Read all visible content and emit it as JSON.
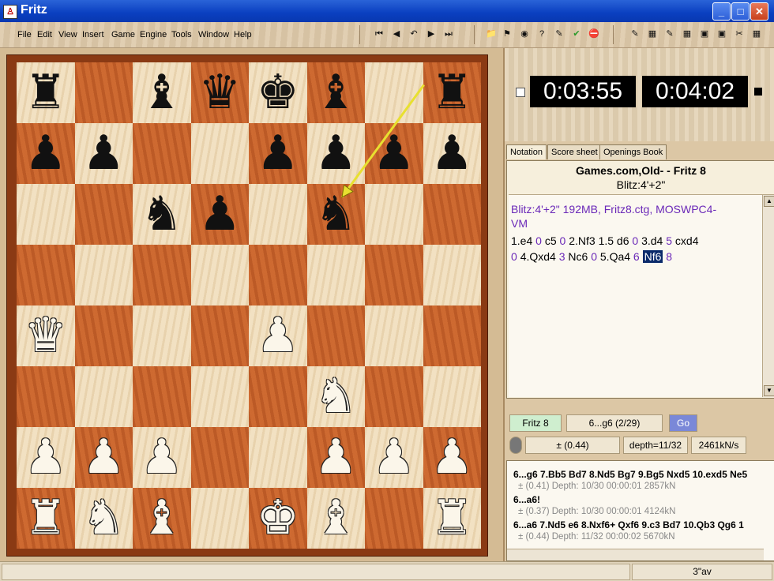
{
  "window": {
    "title": "Fritz",
    "app_icon": "chess-app-icon"
  },
  "menu": [
    "File",
    "Edit",
    "View",
    "Insert",
    "Game",
    "Engine",
    "Tools",
    "Window",
    "Help"
  ],
  "toolbar": {
    "nav": [
      "⏮",
      "◀",
      "↶",
      "▶",
      "⏭"
    ],
    "tools": [
      "📁",
      "⚑",
      "◉",
      "?",
      "✎",
      "✔",
      "⛔",
      "✎",
      "▦",
      "✎",
      "▦",
      "▣",
      "▣",
      "✂",
      "▦"
    ]
  },
  "clocks": {
    "left": "0:03:55",
    "right": "0:04:02"
  },
  "tabs": [
    "Notation",
    "Score sheet",
    "Openings Book"
  ],
  "notation": {
    "header_line1": "Games.com,Old- - Fritz 8",
    "header_line2": "Blitz:4'+2\"",
    "info_line1": "Blitz:4'+2\"  192MB, Fritz8.ctg, MOSWPC4-",
    "info_line2": "VM",
    "moves_line1": [
      "1.e4",
      "0",
      "c5",
      "0",
      "2.Nf3",
      "1.5",
      "d6",
      "0",
      "3.d4",
      "5",
      "cxd4"
    ],
    "moves_line2": [
      "0",
      "4.Qxd4",
      "3",
      "Nc6",
      "0",
      "5.Qa4",
      "6",
      "Nf6",
      "8"
    ]
  },
  "engine": {
    "name": "Fritz 8",
    "current": "6...g6 (2/29)",
    "go": "Go",
    "eval": "± (0.44)",
    "depth": "depth=11/32",
    "speed": "2461kN/s"
  },
  "analysis": [
    {
      "line": "6...g6 7.Bb5 Bd7 8.Nd5 Bg7 9.Bg5 Nxd5 10.exd5 Ne5",
      "info": "± (0.41)  Depth: 10/30  00:00:01  2857kN"
    },
    {
      "line": "6...a6!",
      "info": "± (0.37)  Depth: 10/30  00:00:01  4124kN"
    },
    {
      "line": "6...a6 7.Nd5 e6 8.Nxf6+ Qxf6 9.c3 Bd7 10.Qb3 Qg6 1",
      "info": "± (0.44)  Depth: 11/32  00:00:02  5670kN"
    }
  ],
  "status": {
    "right_text": "3\"av"
  },
  "board": {
    "rows": [
      [
        "r",
        "",
        "b",
        "q",
        "k",
        "b",
        "",
        "r"
      ],
      [
        "p",
        "p",
        "",
        "",
        "p",
        "p",
        "p",
        "p"
      ],
      [
        "",
        "",
        "n",
        "p",
        "",
        "n",
        "",
        ""
      ],
      [
        "",
        "",
        "",
        "",
        "",
        "",
        "",
        ""
      ],
      [
        "Q",
        "",
        "",
        "",
        "P",
        "",
        "",
        ""
      ],
      [
        "",
        "",
        "",
        "",
        "",
        "N",
        "",
        ""
      ],
      [
        "P",
        "P",
        "P",
        "",
        "",
        "P",
        "P",
        "P"
      ],
      [
        "R",
        "N",
        "B",
        "",
        "K",
        "B",
        "",
        "R"
      ]
    ],
    "arrow": {
      "from": "g8",
      "to": "f6",
      "color": "#e8e030"
    }
  }
}
